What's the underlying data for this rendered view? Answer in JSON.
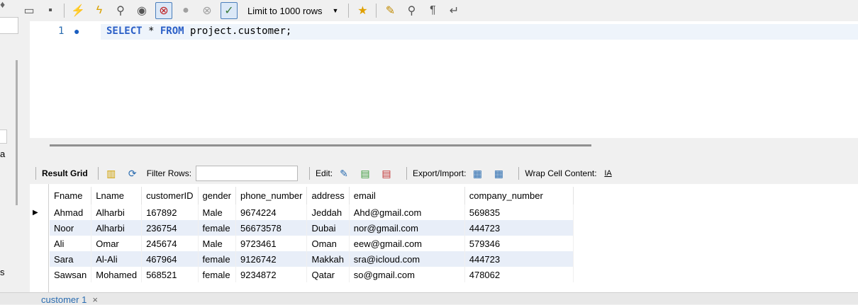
{
  "toolbar": {
    "limit_select": "Limit to 1000 rows"
  },
  "editor": {
    "line_number": "1",
    "code_keyword_select": "SELECT",
    "code_star": " * ",
    "code_keyword_from": "FROM",
    "code_table": " project.customer;"
  },
  "left_panel": {
    "char_a": "a",
    "char_s": "s"
  },
  "result_toolbar": {
    "result_grid": "Result Grid",
    "filter_rows": "Filter Rows:",
    "filter_value": "",
    "edit": "Edit:",
    "export_import": "Export/Import:",
    "wrap_cell": "Wrap Cell Content:"
  },
  "grid": {
    "columns": [
      "Fname",
      "Lname",
      "customerID",
      "gender",
      "phone_number",
      "address",
      "email",
      "company_number"
    ],
    "rows": [
      [
        "Ahmad",
        "Alharbi",
        "167892",
        "Male",
        "9674224",
        "Jeddah",
        "Ahd@gmail.com",
        "569835"
      ],
      [
        "Noor",
        "Alharbi",
        "236754",
        "female",
        "56673578",
        "Dubai",
        "nor@gmail.com",
        "444723"
      ],
      [
        "Ali",
        "Omar",
        "245674",
        "Male",
        "9723461",
        "Oman",
        "eew@gmail.com",
        "579346"
      ],
      [
        "Sara",
        "Al-Ali",
        "467964",
        "female",
        "9126742",
        "Makkah",
        "sra@icloud.com",
        "444723"
      ],
      [
        "Sawsan",
        "Mohamed",
        "568521",
        "female",
        "9234872",
        "Qatar",
        "so@gmail.com",
        "478062"
      ]
    ]
  },
  "bottom_tab": {
    "label": "customer 1",
    "close": "×"
  },
  "colors": {
    "keyword": "#2b5fc7",
    "alt_row": "#e8eef8",
    "tab_text": "#2a6cb0"
  }
}
